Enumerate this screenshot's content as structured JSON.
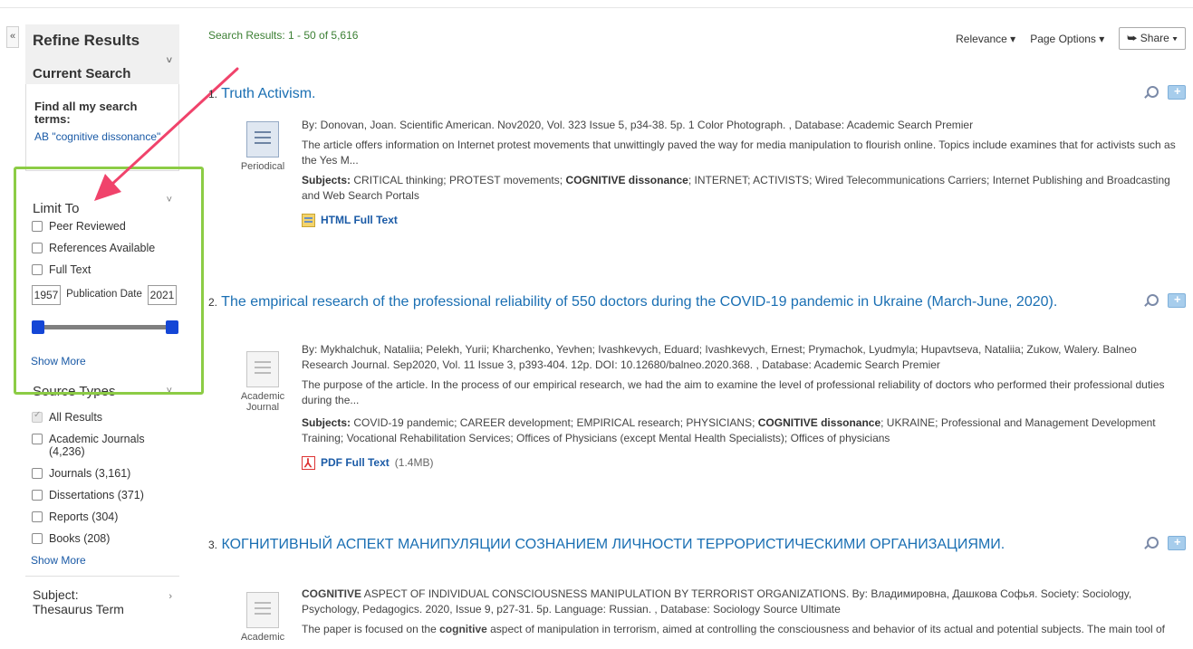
{
  "sidebar": {
    "collapse_label": "«",
    "refine_title": "Refine Results",
    "current_search": {
      "heading": "Current Search",
      "find_label": "Find all my search terms:",
      "term": "AB \"cognitive dissonance\""
    },
    "limit_to": {
      "heading": "Limit To",
      "options": [
        "Peer Reviewed",
        "References Available",
        "Full Text"
      ],
      "date_from": "1957",
      "date_to": "2021",
      "date_label": "Publication Date",
      "show_more": "Show More"
    },
    "source_types": {
      "heading": "Source Types",
      "options": [
        "All Results",
        "Academic Journals (4,236)",
        "Journals (3,161)",
        "Dissertations (371)",
        "Reports (304)",
        "Books (208)"
      ],
      "show_more": "Show More"
    },
    "subject_thesaurus": "Subject: Thesaurus Term"
  },
  "main": {
    "results_count": "Search Results: 1 - 50 of 5,616",
    "toolbar": {
      "relevance": "Relevance ▾",
      "page_options": "Page Options ▾",
      "share": "⮩ Share ▾"
    },
    "results": [
      {
        "number": "1.",
        "title": "Truth Activism.",
        "pub_type": "Periodical",
        "citation": "By: Donovan, Joan. Scientific American. Nov2020, Vol. 323 Issue 5, p34-38. 5p. 1 Color Photograph. , Database: Academic Search Premier",
        "abstract": "The article offers information on Internet protest movements that unwittingly paved the way for media manipulation to flourish online. Topics include examines that for activists such as the Yes M...",
        "subjects_label": "Subjects:",
        "subjects_a": "CRITICAL thinking; PROTEST movements;",
        "subjects_bold": "COGNITIVE dissonance",
        "subjects_b": "; INTERNET; ACTIVISTS; Wired Telecommunications Carriers; Internet Publishing and Broadcasting and Web Search Portals",
        "fulltext": "HTML Full Text"
      },
      {
        "number": "2.",
        "title": "The empirical research of the professional reliability of 550 doctors during the COVID-19 pandemic in Ukraine (March-June, 2020).",
        "pub_type": "Academic Journal",
        "citation": "By: Mykhalchuk, Nataliia; Pelekh, Yurii; Kharchenko, Yevhen; Ivashkevych, Eduard; Ivashkevych, Ernest; Prymachok, Lyudmyla; Hupavtseva, Nataliia; Zukow, Walery. Balneo Research Journal. Sep2020, Vol. 11 Issue 3, p393-404. 12p. DOI: 10.12680/balneo.2020.368. , Database: Academic Search Premier",
        "abstract": "The purpose of the article. In the process of our empirical research, we had the aim to examine the level of professional reliability of doctors who performed their professional duties during the...",
        "subjects_label": "Subjects:",
        "subjects_a": "COVID-19 pandemic; CAREER development; EMPIRICAL research; PHYSICIANS;",
        "subjects_bold": "COGNITIVE dissonance",
        "subjects_b": "; UKRAINE; Professional and Management Development Training; Vocational Rehabilitation Services; Offices of Physicians (except Mental Health Specialists); Offices of physicians",
        "fulltext": "PDF Full Text",
        "fulltext_size": "(1.4MB)"
      },
      {
        "number": "3.",
        "title": "КОГНИТИВНЫЙ АСПЕКТ МАНИПУЛЯЦИИ СОЗНАНИЕМ ЛИЧНОСТИ ТЕРРОРИСТИЧЕСКИМИ ОРГАНИЗАЦИЯМИ.",
        "pub_type": "Academic",
        "citation_bold": "COGNITIVE",
        "citation": " ASPECT OF INDIVIDUAL CONSCIOUSNESS MANIPULATION BY TERRORIST ORGANIZATIONS. By: Владимировна, Дашкова Софья. Society: Sociology, Psychology, Pedagogics. 2020, Issue 9, p27-31. 5p. Language: Russian. , Database: Sociology Source Ultimate",
        "abstract_a": "The paper is focused on the ",
        "abstract_bold": "cognitive",
        "abstract_b": " aspect of manipulation in terrorism, aimed at controlling the consciousness and behavior of its actual and potential subjects. The main tool of"
      }
    ]
  },
  "colors": {
    "highlight_box": "#8ccc45",
    "annotation_arrow": "#f0436b",
    "link": "#1a6fb3",
    "slider_handle": "#1446d6",
    "results_count": "#3b7f33"
  }
}
